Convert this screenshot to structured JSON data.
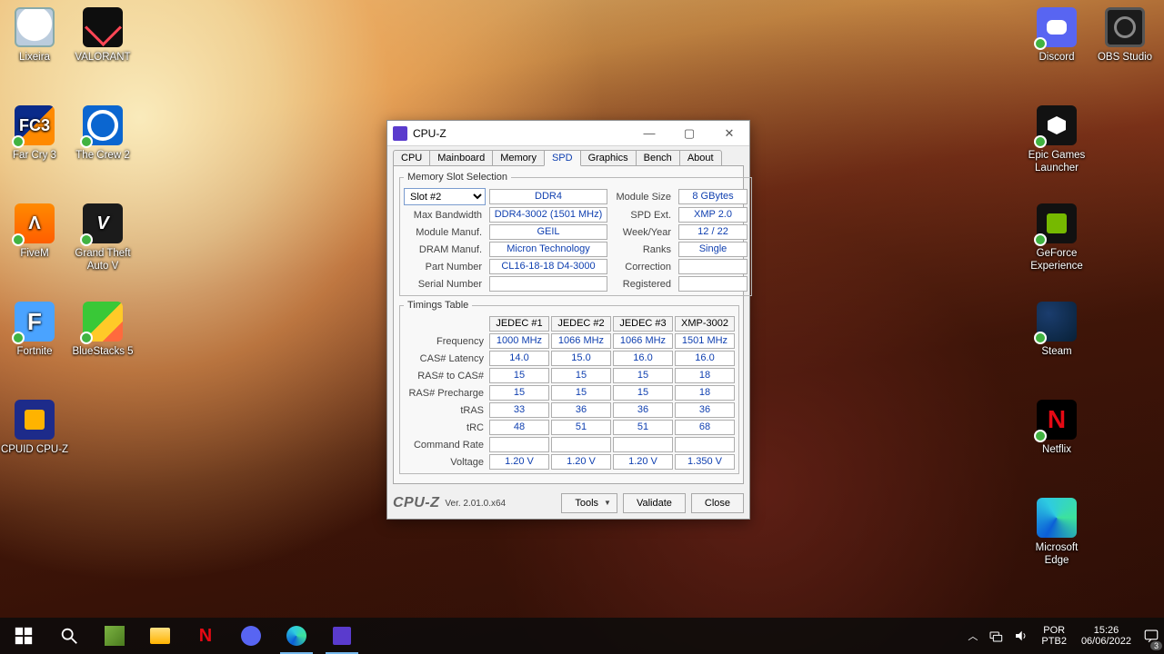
{
  "desktop": {
    "left": [
      {
        "k": "bin",
        "label": "Lixeira"
      },
      {
        "k": "val",
        "label": "VALORANT"
      },
      {
        "k": "fc3",
        "label": "Far Cry 3",
        "txt": "FC3",
        "dot": true
      },
      {
        "k": "crew",
        "label": "The Crew 2",
        "dot": true
      },
      {
        "k": "fivem",
        "label": "FiveM",
        "txt": "Λ",
        "dot": true
      },
      {
        "k": "gtav",
        "label": "Grand Theft Auto V",
        "txt": "V",
        "dot": true
      },
      {
        "k": "fort",
        "label": "Fortnite",
        "txt": "F",
        "dot": true
      },
      {
        "k": "blue",
        "label": "BlueStacks 5",
        "dot": true
      },
      {
        "k": "cpuz",
        "label": "CPUID CPU-Z"
      }
    ],
    "right": [
      {
        "k": "disc",
        "label": "Discord",
        "dot": true
      },
      {
        "k": "obs",
        "label": "OBS Studio"
      },
      {
        "k": "epic",
        "label": "Epic Games Launcher",
        "dot": true
      },
      {
        "k": "nv",
        "label": "GeForce Experience",
        "dot": true
      },
      {
        "k": "steam",
        "label": "Steam",
        "dot": true
      },
      {
        "k": "nfx",
        "label": "Netflix",
        "txt": "N",
        "dot": true
      },
      {
        "k": "edge",
        "label": "Microsoft Edge"
      }
    ]
  },
  "taskbar": {
    "lang": "POR",
    "kbd": "PTB2",
    "time": "15:26",
    "date": "06/06/2022",
    "notif": "3"
  },
  "win": {
    "title": "CPU-Z",
    "tabs": [
      "CPU",
      "Mainboard",
      "Memory",
      "SPD",
      "Graphics",
      "Bench",
      "About"
    ],
    "activeTab": "SPD",
    "slotLegend": "Memory Slot Selection",
    "slotSel": "Slot #2",
    "fields": {
      "type": {
        "l": "",
        "v": "DDR4"
      },
      "bw": {
        "l": "Max Bandwidth",
        "v": "DDR4-3002 (1501 MHz)"
      },
      "mm": {
        "l": "Module Manuf.",
        "v": "GEIL"
      },
      "dm": {
        "l": "DRAM Manuf.",
        "v": "Micron Technology"
      },
      "pn": {
        "l": "Part Number",
        "v": "CL16-18-18 D4-3000"
      },
      "sn": {
        "l": "Serial Number",
        "v": ""
      },
      "ms": {
        "l": "Module Size",
        "v": "8 GBytes"
      },
      "se": {
        "l": "SPD Ext.",
        "v": "XMP 2.0"
      },
      "wy": {
        "l": "Week/Year",
        "v": "12 / 22"
      },
      "rk": {
        "l": "Ranks",
        "v": "Single"
      },
      "cr": {
        "l": "Correction",
        "v": ""
      },
      "rg": {
        "l": "Registered",
        "v": ""
      }
    },
    "timLegend": "Timings Table",
    "timCols": [
      "JEDEC #1",
      "JEDEC #2",
      "JEDEC #3",
      "XMP-3002"
    ],
    "timRows": [
      {
        "l": "Frequency",
        "v": [
          "1000 MHz",
          "1066 MHz",
          "1066 MHz",
          "1501 MHz"
        ]
      },
      {
        "l": "CAS# Latency",
        "v": [
          "14.0",
          "15.0",
          "16.0",
          "16.0"
        ]
      },
      {
        "l": "RAS# to CAS#",
        "v": [
          "15",
          "15",
          "15",
          "18"
        ]
      },
      {
        "l": "RAS# Precharge",
        "v": [
          "15",
          "15",
          "15",
          "18"
        ]
      },
      {
        "l": "tRAS",
        "v": [
          "33",
          "36",
          "36",
          "36"
        ]
      },
      {
        "l": "tRC",
        "v": [
          "48",
          "51",
          "51",
          "68"
        ]
      },
      {
        "l": "Command Rate",
        "v": [
          "",
          "",
          "",
          ""
        ]
      },
      {
        "l": "Voltage",
        "v": [
          "1.20 V",
          "1.20 V",
          "1.20 V",
          "1.350 V"
        ]
      }
    ],
    "footer": {
      "logo": "CPU-Z",
      "ver": "Ver. 2.01.0.x64",
      "tools": "Tools",
      "validate": "Validate",
      "close": "Close"
    }
  }
}
